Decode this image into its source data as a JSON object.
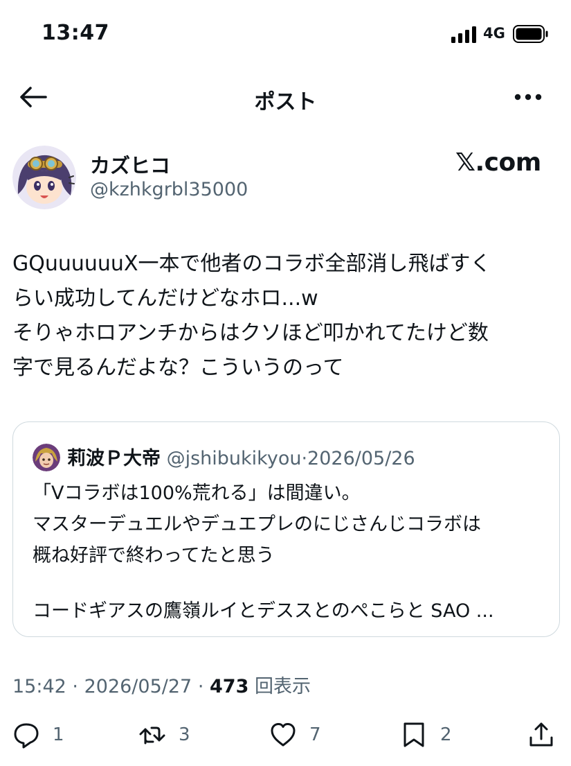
{
  "status_bar": {
    "time": "13:47",
    "network": "4G",
    "icons": [
      "signal-icon",
      "battery-icon"
    ]
  },
  "nav": {
    "title": "ポスト",
    "icons": [
      "back-arrow-icon",
      "more-icon"
    ]
  },
  "author": {
    "name": "カズヒコ",
    "handle": "@kzhkgrbl35000"
  },
  "brand": "𝕏.com",
  "tweet": {
    "text": "GQuuuuuuX一本で他者のコラボ全部消し飛ばすく\nらい成功してんだけどなホロ...w\nそりゃホロアンチからはクソほど叩かれてたけど数\n字で見るんだよな？こういうのって"
  },
  "quote": {
    "name": "莉波Ｐ大帝",
    "handle": "@jshibukikyou",
    "separator": "·",
    "date": "2026/05/26",
    "text": "「Vコラボは100%荒れる」は間違い。\nマスターデュエルやデュエプレのにじさんじコラボは\n概ね好評で終わってたと思う",
    "last_line": "コードギアスの鷹嶺ルイとデススとのぺこらと SAO ..."
  },
  "meta": {
    "time": "15:42",
    "separator": "·",
    "date": "2026/05/27",
    "views_count": "473",
    "views_label": "回表示"
  },
  "actions": {
    "reply_count": "1",
    "repost_count": "3",
    "like_count": "7",
    "bookmark_count": "2",
    "icons": [
      "reply-icon",
      "repost-icon",
      "like-icon",
      "bookmark-icon",
      "share-icon"
    ]
  },
  "colors": {
    "text": "#0f1419",
    "secondary": "#536471",
    "border": "#cfd9de",
    "background": "#ffffff"
  }
}
